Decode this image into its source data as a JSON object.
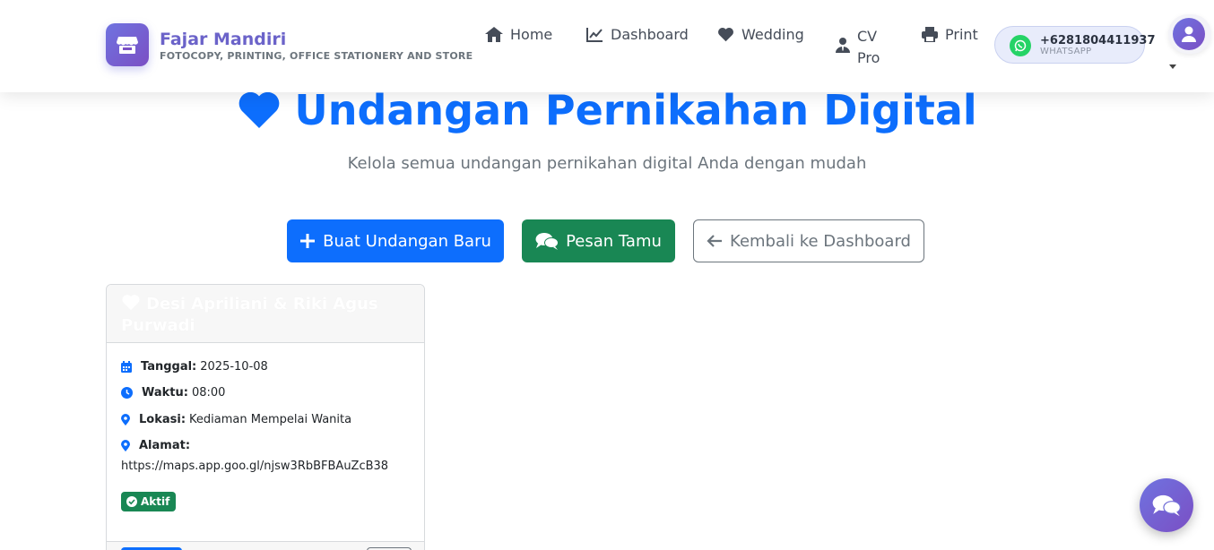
{
  "brand": {
    "name": "Fajar Mandiri",
    "tagline": "FOTOCOPY, PRINTING, OFFICE STATIONERY AND STORE"
  },
  "nav": {
    "home": "Home",
    "dashboard": "Dashboard",
    "wedding": "Wedding",
    "cv_line1": "CV",
    "cv_line2": "Pro",
    "print": "Print"
  },
  "whatsapp": {
    "number": "+6281804411937",
    "label": "WHATSAPP"
  },
  "hero": {
    "title": "Undangan Pernikahan Digital",
    "subtitle": "Kelola semua undangan pernikahan digital Anda dengan mudah"
  },
  "actions": {
    "create": "Buat Undangan Baru",
    "messages": "Pesan Tamu",
    "back": "Kembali ke Dashboard"
  },
  "invitation": {
    "title": "Desi Apriliani & Riki Agus Purwadi",
    "date_label": "Tanggal:",
    "date": "2025-10-08",
    "time_label": "Waktu:",
    "time": "08:00",
    "location_label": "Lokasi:",
    "location": "Kediaman Mempelai Wanita",
    "address_label": "Alamat:",
    "address": "https://maps.app.goo.gl/njsw3RbBFBAuZcB38",
    "status": "Aktif"
  },
  "colors": {
    "primary": "#0d6efd",
    "success": "#198754",
    "brand": "#6f73e0",
    "muted": "#6c757d"
  }
}
